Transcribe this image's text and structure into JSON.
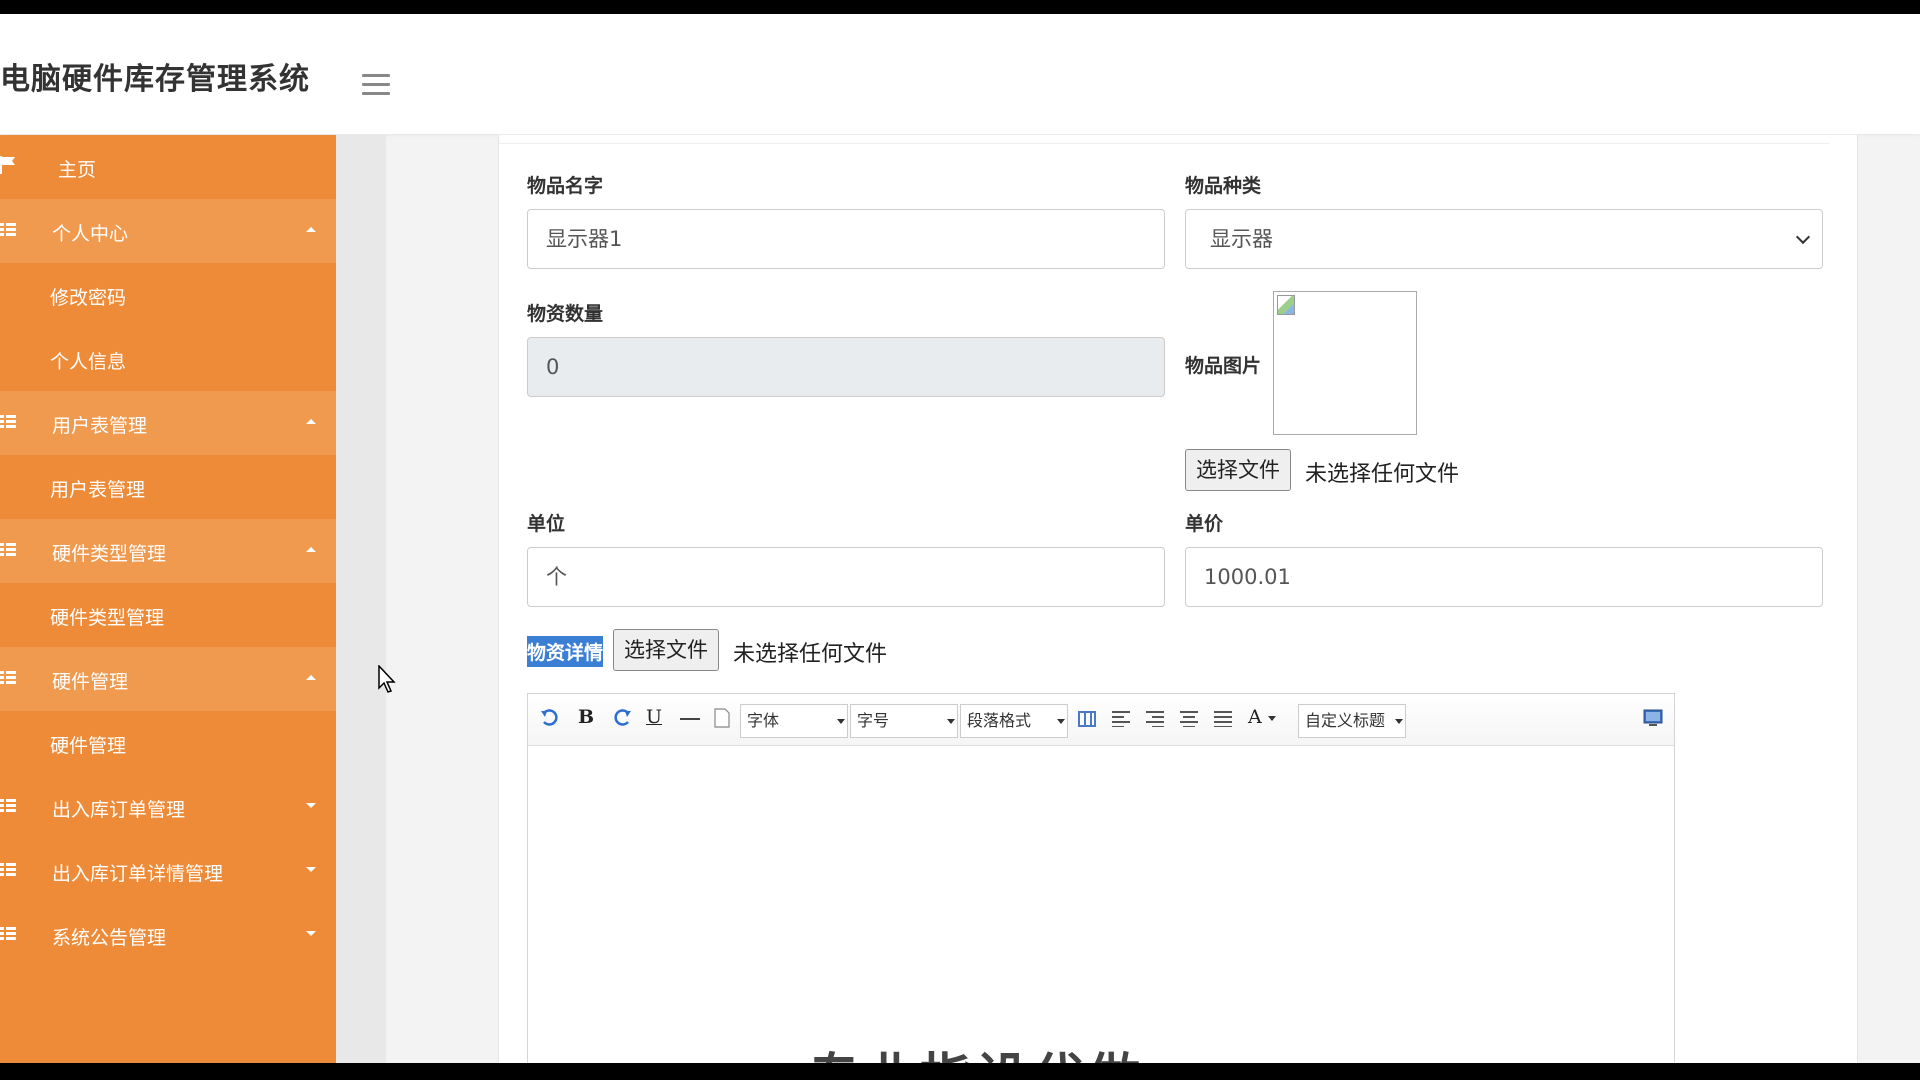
{
  "header": {
    "app_title": "电脑硬件库存管理系统"
  },
  "sidebar": {
    "items": [
      {
        "label": "主页",
        "type": "home"
      },
      {
        "label": "个人中心",
        "type": "parent",
        "expanded": true
      },
      {
        "label": "修改密码",
        "type": "child"
      },
      {
        "label": "个人信息",
        "type": "child"
      },
      {
        "label": "用户表管理",
        "type": "parent",
        "expanded": true
      },
      {
        "label": "用户表管理",
        "type": "child"
      },
      {
        "label": "硬件类型管理",
        "type": "parent",
        "expanded": true
      },
      {
        "label": "硬件类型管理",
        "type": "child"
      },
      {
        "label": "硬件管理",
        "type": "parent",
        "expanded": true
      },
      {
        "label": "硬件管理",
        "type": "child"
      },
      {
        "label": "出入库订单管理",
        "type": "parent",
        "expanded": false
      },
      {
        "label": "出入库订单详情管理",
        "type": "parent",
        "expanded": false
      },
      {
        "label": "系统公告管理",
        "type": "parent",
        "expanded": false
      }
    ]
  },
  "form": {
    "item_name": {
      "label": "物品名字",
      "value": "显示器1"
    },
    "item_category": {
      "label": "物品种类",
      "value": "显示器"
    },
    "quantity": {
      "label": "物资数量",
      "value": "0"
    },
    "item_image": {
      "label": "物品图片",
      "button": "选择文件",
      "status": "未选择任何文件"
    },
    "unit": {
      "label": "单位",
      "value": "个"
    },
    "unit_price": {
      "label": "单价",
      "value": "1000.01"
    },
    "details": {
      "label": "物资详情",
      "button": "选择文件",
      "status": "未选择任何文件"
    }
  },
  "editor": {
    "bold": "B",
    "underline": "U",
    "font_color": "A",
    "font_family": "字体",
    "font_size": "字号",
    "paragraph": "段落格式",
    "custom_title": "自定义标题"
  },
  "overlay": {
    "watermark": "专业指设代做"
  },
  "colors": {
    "sidebar": "#ee8b38",
    "sidebar_parent": "#f09a4f",
    "highlight": "#3b7fd4"
  }
}
